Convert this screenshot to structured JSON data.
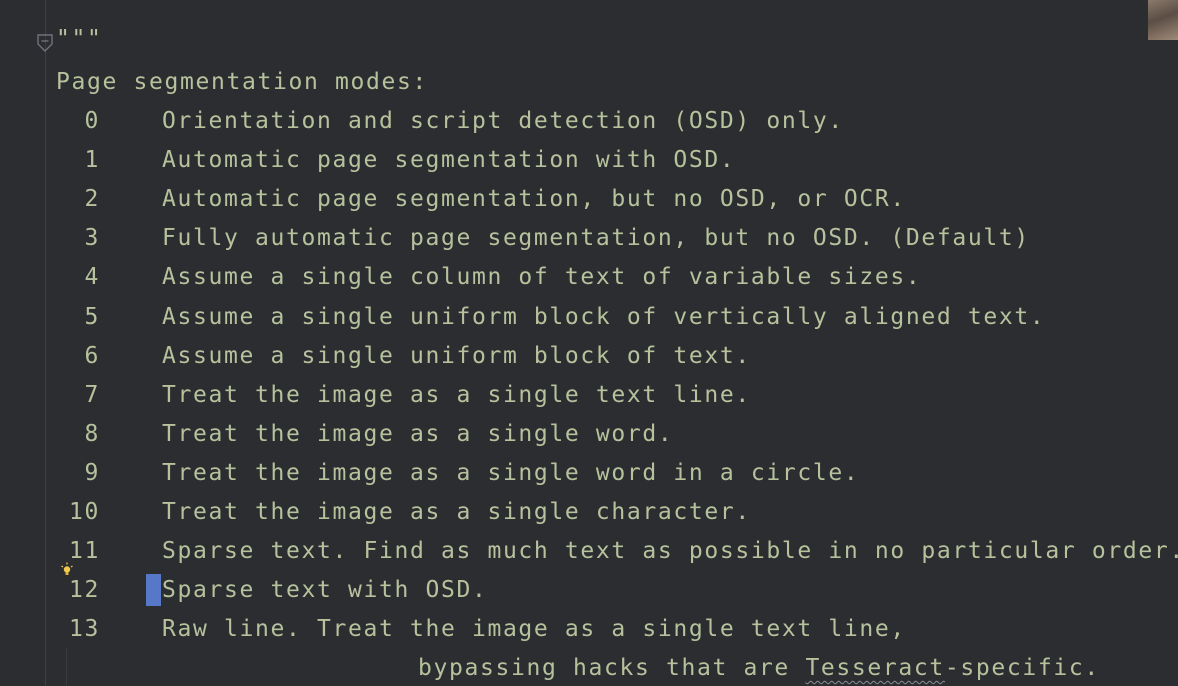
{
  "docstring_open": "\"\"\"",
  "heading": "Page segmentation modes:",
  "modes": [
    {
      "num": "0",
      "text": "Orientation and script detection (OSD) only."
    },
    {
      "num": "1",
      "text": "Automatic page segmentation with OSD."
    },
    {
      "num": "2",
      "text": "Automatic page segmentation, but no OSD, or OCR."
    },
    {
      "num": "3",
      "text": "Fully automatic page segmentation, but no OSD. (Default)"
    },
    {
      "num": "4",
      "text": "Assume a single column of text of variable sizes."
    },
    {
      "num": "5",
      "text": "Assume a single uniform block of vertically aligned text."
    },
    {
      "num": "6",
      "text": "Assume a single uniform block of text."
    },
    {
      "num": "7",
      "text": "Treat the image as a single text line."
    },
    {
      "num": "8",
      "text": "Treat the image as a single word."
    },
    {
      "num": "9",
      "text": "Treat the image as a single word in a circle."
    },
    {
      "num": "10",
      "text": "Treat the image as a single character."
    },
    {
      "num": "11",
      "text": "Sparse text. Find as much text as possible in no particular order."
    },
    {
      "num": "12",
      "text": "Sparse text with OSD."
    },
    {
      "num": "13",
      "text": "Raw line. Treat the image as a single text line,"
    }
  ],
  "continuation": {
    "before": "bypassing hacks that are ",
    "squiggled": "Tesseract",
    "after": "-specific."
  },
  "colors": {
    "background": "#2b2d31",
    "docstring_text": "#b7c19c",
    "caret": "#5777c9",
    "intention_bulb": "#f2c94c"
  },
  "icons": {
    "fold": "fold-marker-icon",
    "bulb": "lightbulb-icon"
  }
}
